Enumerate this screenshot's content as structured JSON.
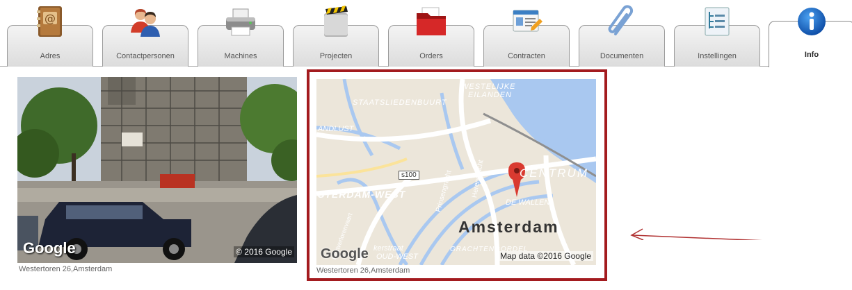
{
  "tabs": [
    {
      "label": "Adres",
      "icon": "address-book-icon",
      "active": false
    },
    {
      "label": "Contactpersonen",
      "icon": "contact-persons-icon",
      "active": false
    },
    {
      "label": "Machines",
      "icon": "printer-icon",
      "active": false
    },
    {
      "label": "Projecten",
      "icon": "clapperboard-folder-icon",
      "active": false
    },
    {
      "label": "Orders",
      "icon": "red-folder-icon",
      "active": false
    },
    {
      "label": "Contracten",
      "icon": "contract-card-icon",
      "active": false
    },
    {
      "label": "Documenten",
      "icon": "paperclip-icon",
      "active": false
    },
    {
      "label": "Instellingen",
      "icon": "settings-tree-icon",
      "active": false
    },
    {
      "label": "Info",
      "icon": "info-icon",
      "active": true
    }
  ],
  "streetview": {
    "google_logo": "Google",
    "copyright": "© 2016 Google",
    "caption": "Westertoren 26,Amsterdam"
  },
  "map": {
    "labels": {
      "westelijke": "WESTELIJKE",
      "eilanden": "EILANDEN",
      "staatslieden": "STAATSLIEDENBUURT",
      "andlust": "ANDLUST",
      "s100": "s100",
      "centrum": "CENTRUM",
      "westpart": "STERDAM-WEST",
      "wallen": "DE WALLEN",
      "city": "Amsterdam",
      "prinsengracht": "Prinsengracht",
      "herengracht": "Herengracht",
      "kerstraat": "kerstraat",
      "oudwest": "OUD-WEST",
      "grachtengordel": "GRACHTENGORDEL",
      "kinkerinvaart": "Kostverlorenvaart"
    },
    "google_logo": "Google",
    "attribution": "Map data ©2016 Google",
    "caption": "Westertoren 26,Amsterdam"
  },
  "colors": {
    "highlight_frame": "#a31b1f",
    "arrow": "#b03030",
    "water": "#a9c8f0",
    "map_pin": "#d93a30"
  }
}
